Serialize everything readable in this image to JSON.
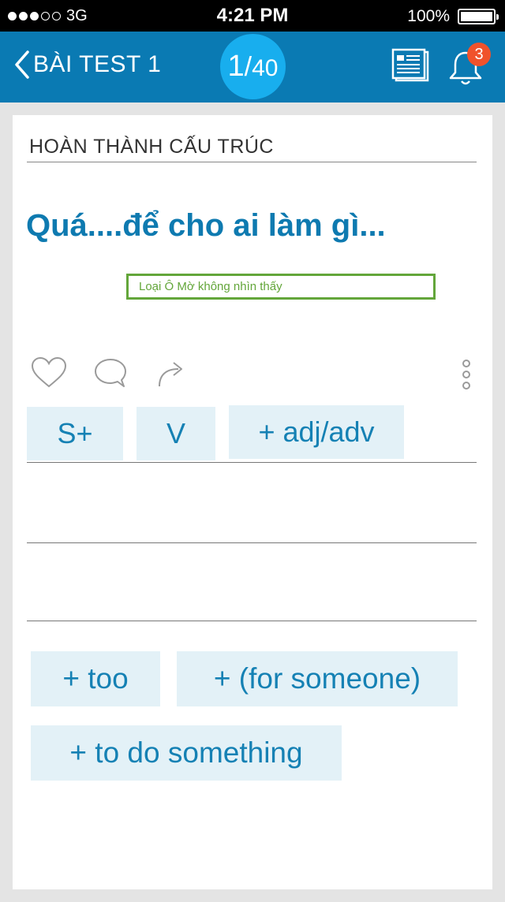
{
  "status_bar": {
    "carrier": "3G",
    "time": "4:21 PM",
    "battery": "100%"
  },
  "nav": {
    "back_label": "BÀI TEST 1",
    "progress_current": "1",
    "progress_separator": "/",
    "progress_total": "40",
    "notification_count": "3"
  },
  "card": {
    "section_title": "HOÀN THÀNH CẤU TRÚC",
    "question": "Quá....để cho ai làm gì...",
    "hint": "Loại Ô  Mờ không nhìn thấy",
    "answer_chips": [
      "S+",
      "V",
      "+ adj/adv"
    ],
    "options": [
      "+ too",
      "+ (for someone)",
      "+ to do something"
    ]
  },
  "colors": {
    "nav_background": "#0a7ab3",
    "progress_circle": "#18aeee",
    "accent_text": "#0e7ab0",
    "chip_background": "#e3f1f7",
    "hint_border": "#63a63a",
    "badge": "#f0522b"
  },
  "icons": {
    "back": "chevron-left-icon",
    "document": "news-document-icon",
    "bell": "bell-icon",
    "like": "heart-icon",
    "comment": "comment-icon",
    "share": "share-arrow-icon",
    "more": "more-vertical-icon"
  }
}
